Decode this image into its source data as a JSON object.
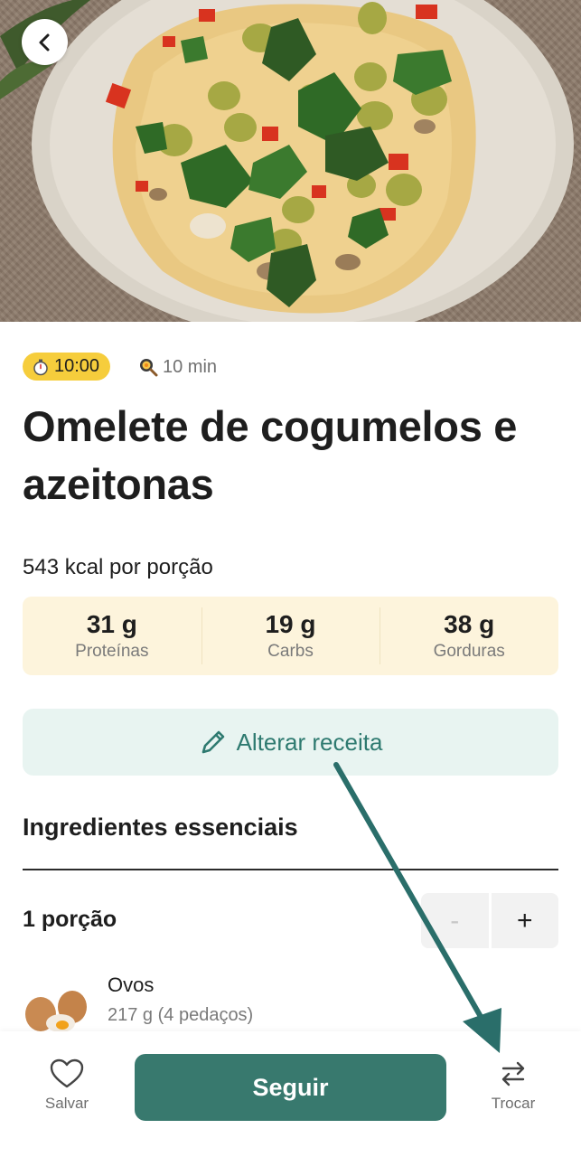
{
  "header": {
    "back_icon": "chevron-left-icon"
  },
  "meta": {
    "timer": "10:00",
    "timer_icon": "stopwatch-icon",
    "cook_time": "10 min",
    "cook_icon": "frying-pan-icon"
  },
  "recipe": {
    "title": "Omelete de cogumelos e azeitonas",
    "kcal": "543 kcal por porção"
  },
  "macros": [
    {
      "value": "31 g",
      "label": "Proteínas"
    },
    {
      "value": "19 g",
      "label": "Carbs"
    },
    {
      "value": "38 g",
      "label": "Gorduras"
    }
  ],
  "alter_button": {
    "label": "Alterar receita",
    "icon": "pencil-icon"
  },
  "ingredients": {
    "section_title": "Ingredientes essenciais",
    "portion_label": "1 porção",
    "minus": "-",
    "plus": "+",
    "items": [
      {
        "name": "Ovos",
        "qty": "217 g (4 pedaços)"
      }
    ]
  },
  "bottom_bar": {
    "save_label": "Salvar",
    "follow_label": "Seguir",
    "swap_label": "Trocar"
  },
  "colors": {
    "accent": "#38796e",
    "timer_badge": "#f6cd3c",
    "macros_bg": "#fdf4dc",
    "alter_bg": "#e8f4f1"
  }
}
